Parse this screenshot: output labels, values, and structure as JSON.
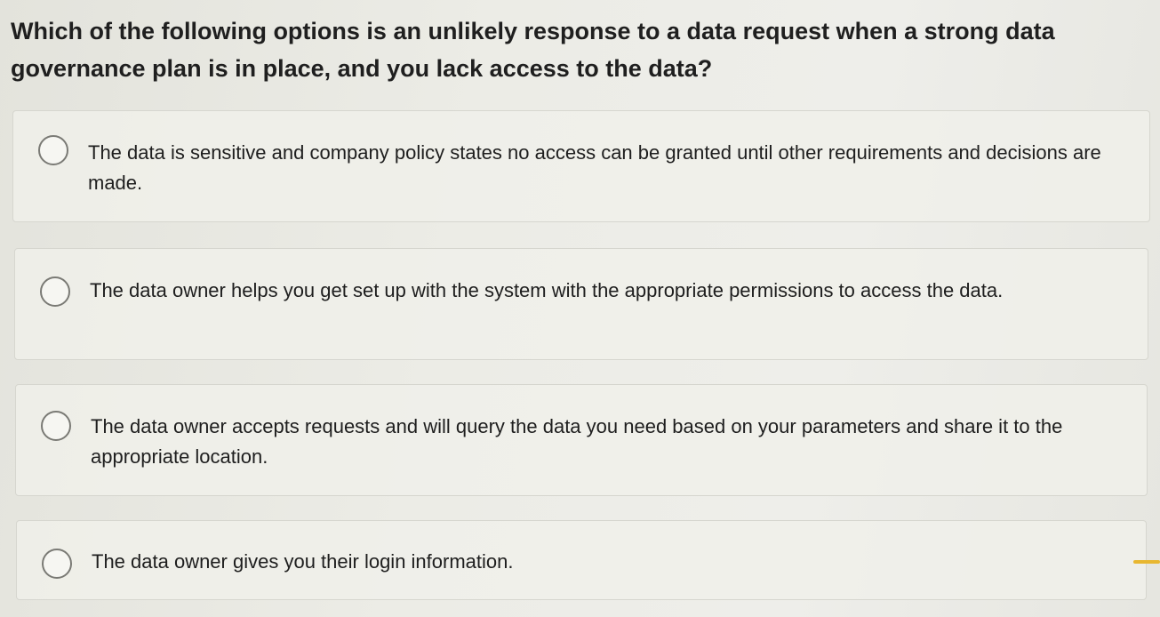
{
  "question": {
    "text": "Which of the following options is an unlikely response to a data request when a strong data governance plan is in place, and you lack access to the data?"
  },
  "options": [
    {
      "label": "The data is sensitive and company policy states no access can be granted until other requirements and decisions are made.",
      "selected": false
    },
    {
      "label": "The data owner helps you get set up with the system with the appropriate permissions to access the data.",
      "selected": false
    },
    {
      "label": "The data owner accepts requests and will query the data you need based on your parameters and share it to the appropriate location.",
      "selected": false
    },
    {
      "label": "The data owner gives you their login information.",
      "selected": false
    }
  ],
  "colors": {
    "background": "#ececE6",
    "radio_border": "#7a7a75",
    "text": "#1e1e1e",
    "edge_mark": "#e8b730"
  }
}
